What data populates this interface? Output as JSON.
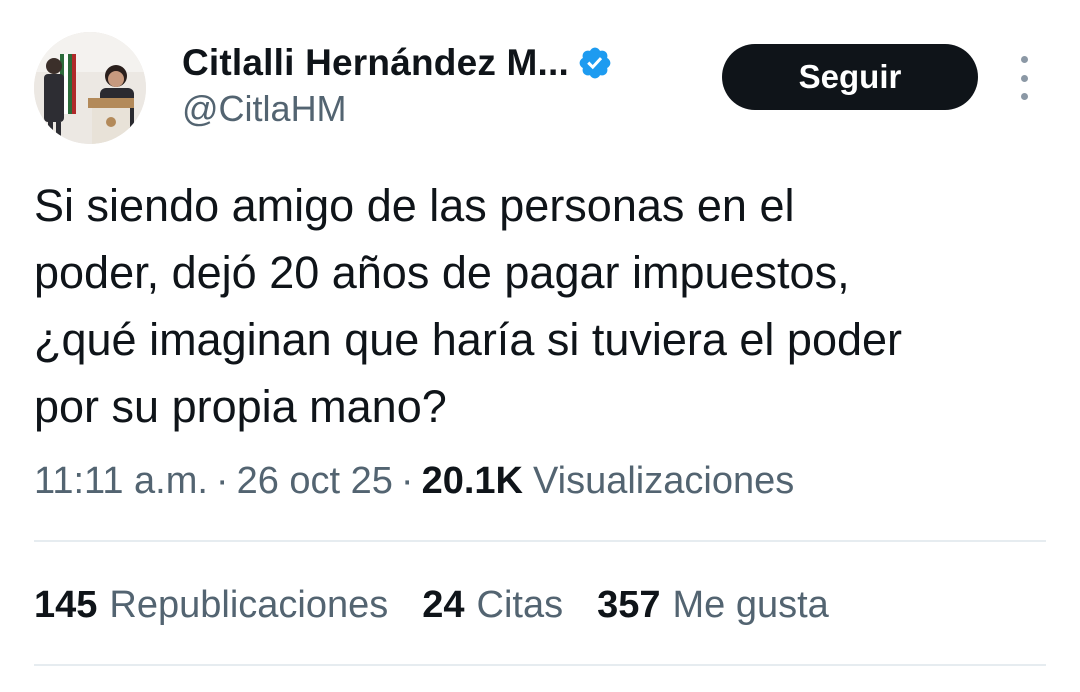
{
  "author": {
    "display_name": "Citlalli Hernández M...",
    "handle": "@CitlaHM",
    "verified": true,
    "verified_color": "#1d9bf0"
  },
  "follow_button": {
    "label": "Seguir"
  },
  "tweet": {
    "text_lines": [
      "Si siendo amigo de las personas en el",
      "poder, dejó 20 años de pagar impuestos,",
      "¿qué imaginan que haría si tuviera el poder",
      "por su propia mano?"
    ]
  },
  "meta": {
    "time": "11:11 a.m.",
    "separator": "·",
    "date": "26 oct 25",
    "views_count": "20.1K",
    "views_label": "Visualizaciones"
  },
  "stats": {
    "reposts_count": "145",
    "reposts_label": "Republicaciones",
    "quotes_count": "24",
    "quotes_label": "Citas",
    "likes_count": "357",
    "likes_label": "Me gusta"
  },
  "icons": {
    "verified": "verified-badge-icon",
    "more": "more-options-icon"
  },
  "colors": {
    "text_primary": "#0f1419",
    "text_secondary": "#536471",
    "button_bg": "#0f1419",
    "divider": "#e6ecf0"
  }
}
